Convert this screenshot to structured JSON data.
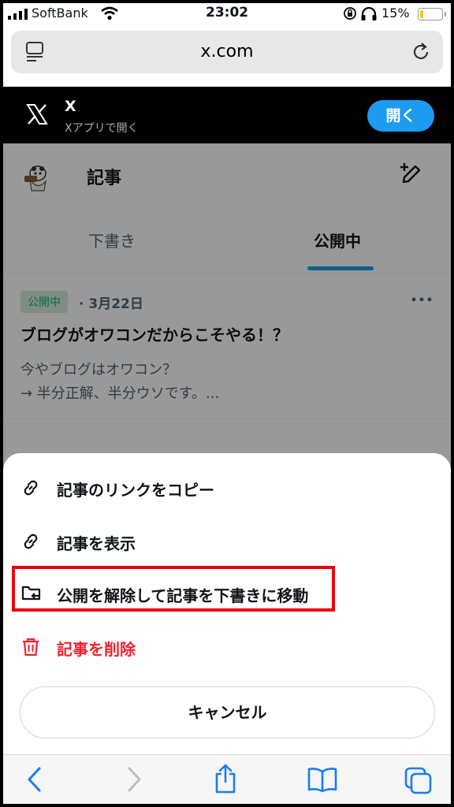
{
  "status_bar": {
    "carrier": "SoftBank",
    "time": "23:02",
    "battery_percent": "15%",
    "battery_level": 0.15,
    "battery_color": "#f5c518"
  },
  "url_bar": {
    "url": "x.com",
    "left_icon": "tabs-icon",
    "right_icon": "reload-icon"
  },
  "app_banner": {
    "app_name": "X",
    "subtitle": "Xアプリで開く",
    "open_button": "開く",
    "accent": "#1d9bf0"
  },
  "page": {
    "title": "記事",
    "tabs": [
      {
        "label": "下書き",
        "active": false
      },
      {
        "label": "公開中",
        "active": true
      }
    ],
    "article": {
      "status_badge": "公開中",
      "date": "· 3月22日",
      "headline": "ブログがオワコンだからこそやる！？",
      "excerpt_line1": "今やブログはオワコン？",
      "excerpt_line2": "→ 半分正解、半分ウソです。..."
    }
  },
  "sheet": {
    "items": [
      {
        "label": "記事のリンクをコピー",
        "icon": "link-icon"
      },
      {
        "label": "記事を表示",
        "icon": "link-icon"
      },
      {
        "label": "公開を解除して記事を下書きに移動",
        "icon": "folder-move-icon",
        "highlighted": true
      },
      {
        "label": "記事を削除",
        "icon": "trash-icon",
        "danger": true
      }
    ],
    "cancel": "キャンセル",
    "danger_color": "#f4212e",
    "highlight_color": "#e8000b"
  },
  "toolbar": {
    "icons": [
      "back-icon",
      "forward-icon",
      "share-icon",
      "bookmarks-icon",
      "tabs-overview-icon"
    ]
  }
}
